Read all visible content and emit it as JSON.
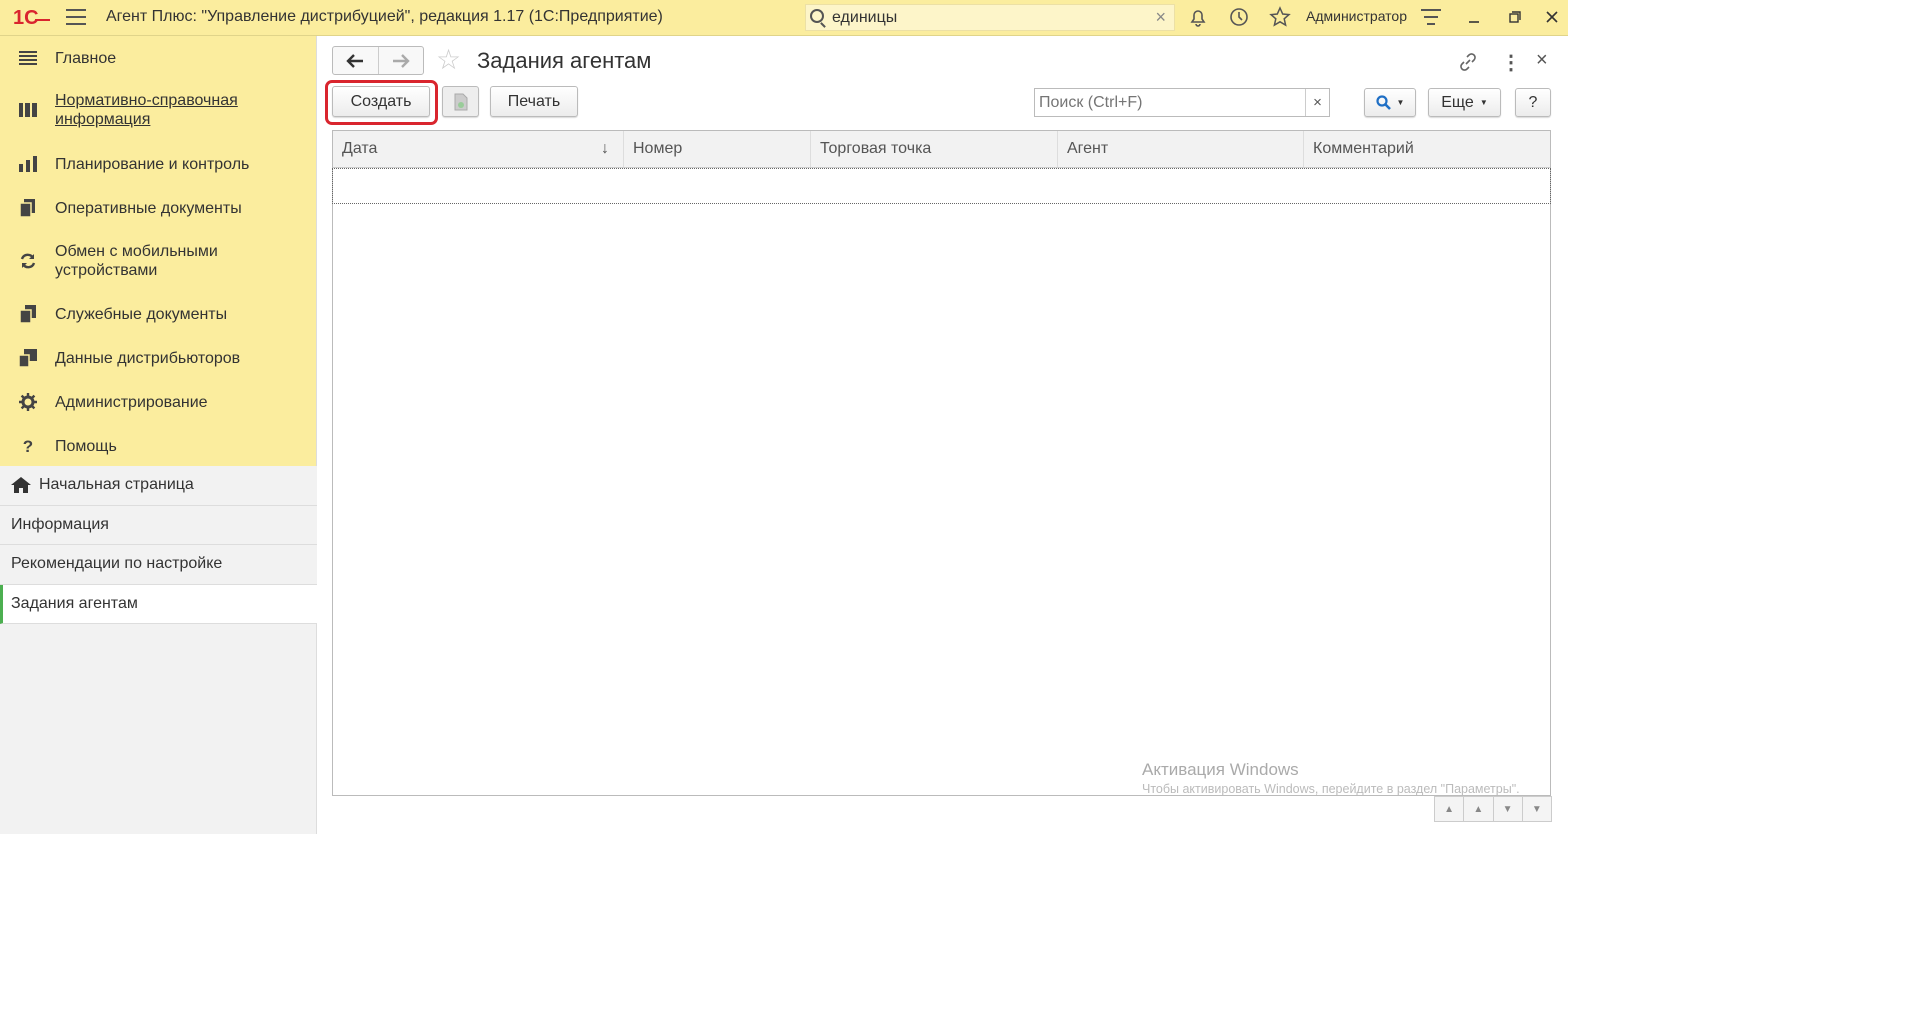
{
  "titlebar": {
    "app_title": "Агент Плюс: \"Управление дистрибуцией\", редакция 1.17  (1С:Предприятие)",
    "search_value": "единицы",
    "user": "Администратор"
  },
  "sidebar": {
    "sections": [
      {
        "label": "Главное",
        "icon": "list-icon"
      },
      {
        "label": "Нормативно-справочная информация",
        "icon": "book-icon"
      },
      {
        "label": "Планирование и контроль",
        "icon": "chart-icon"
      },
      {
        "label": "Оперативные документы",
        "icon": "documents-icon"
      },
      {
        "label": "Обмен с мобильными устройствами",
        "icon": "sync-icon"
      },
      {
        "label": "Служебные документы",
        "icon": "service-docs-icon"
      },
      {
        "label": "Данные дистрибьюторов",
        "icon": "distributors-icon"
      },
      {
        "label": "Администрирование",
        "icon": "gear-icon"
      },
      {
        "label": "Помощь",
        "icon": "help-icon"
      }
    ],
    "nav": [
      {
        "label": "Начальная страница"
      },
      {
        "label": "Информация"
      },
      {
        "label": "Рекомендации по настройке"
      },
      {
        "label": "Задания агентам"
      }
    ]
  },
  "main": {
    "title": "Задания агентам",
    "buttons": {
      "create": "Создать",
      "print": "Печать",
      "more": "Еще",
      "help": "?"
    },
    "search_placeholder": "Поиск (Ctrl+F)",
    "columns": [
      "Дата",
      "Номер",
      "Торговая точка",
      "Агент",
      "Комментарий"
    ],
    "sort_indicator": "↓",
    "watermark_title": "Активация Windows",
    "watermark_text": "Чтобы активировать Windows, перейдите в раздел \"Параметры\"."
  },
  "colors": {
    "titlebar": "#fbed9e",
    "highlight": "#d9252e",
    "active_marker": "#4caf50"
  }
}
